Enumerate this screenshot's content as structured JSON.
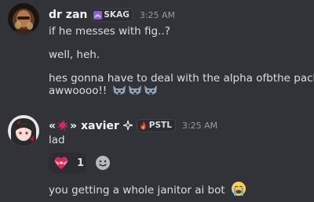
{
  "messages": [
    {
      "author": "dr zan",
      "tag": "SKAG",
      "time": "3:25 AM",
      "lines": [
        "if he messes with fig..?",
        "well, heh.",
        "hes gonna have to deal with the alpha ofbthe pack.",
        "awwoooo!!"
      ],
      "icons": [
        "avatar-portrait",
        "rainbow-tag-icon",
        "wolf-emoji",
        "wolf-emoji",
        "wolf-emoji"
      ]
    },
    {
      "author_prefix": "«",
      "author_suffix": "» xavier",
      "tag": "PSTL",
      "time": "3:25 AM",
      "lines": [
        "lad"
      ],
      "reaction": {
        "emoji": "heart-with-ribbon",
        "count": "1"
      },
      "icons": [
        "avatar-anime",
        "anger-symbol-emoji",
        "sparkle-icon",
        "fire-tag-icon",
        "add-reaction-icon"
      ]
    },
    {
      "lines": [
        "you getting a whole janitor ai bot"
      ],
      "icons": [
        "loudly-crying-face-emoji"
      ]
    }
  ],
  "colors": {
    "background": "#313338",
    "text": "#dbdee1",
    "username": "#f2f3f5",
    "timestamp": "#949ba4",
    "tag_background": "#2b2d31"
  }
}
